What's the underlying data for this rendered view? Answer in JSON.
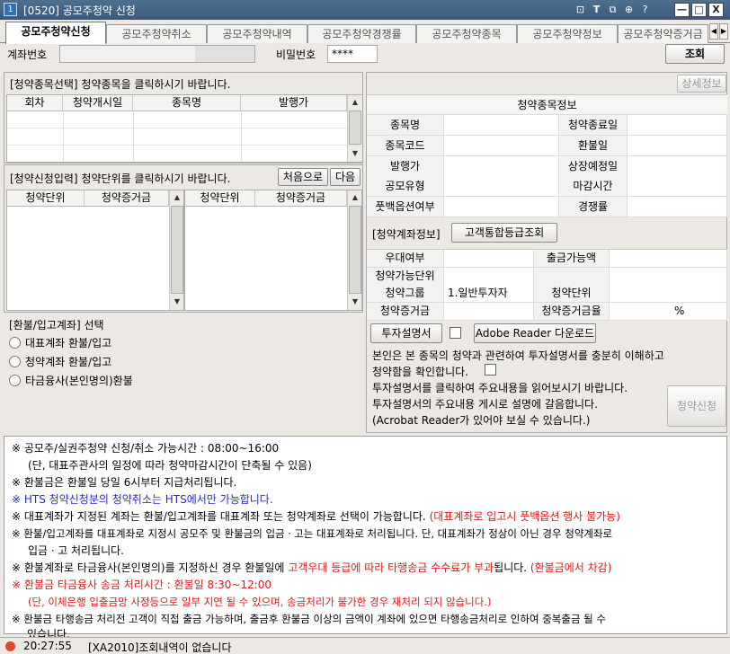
{
  "window": {
    "icon": "1",
    "title": "[0520] 공모주청약 신청",
    "controls": [
      "pin-icon",
      "text-icon",
      "copy-icon",
      "link-icon",
      "help-icon",
      "minimize-icon",
      "maximize-icon",
      "close-icon"
    ],
    "control_glyphs": [
      "⊡",
      "T",
      "⧉",
      "⊕",
      "?"
    ],
    "box_glyphs": [
      "—",
      "□",
      "X"
    ]
  },
  "tabs": [
    "공모주청약신청",
    "공모주청약취소",
    "공모주청약내역",
    "공모주청약경쟁률",
    "공모주청약종목",
    "공모주청약정보",
    "공모주청약증거금"
  ],
  "tab_arrows": {
    "left": "◀",
    "right": "▶"
  },
  "account": {
    "label": "계좌번호",
    "value": "",
    "password_label": "비밀번호",
    "password_value": "****",
    "query_button": "조회"
  },
  "stock_select": {
    "header": "[청약종목선택] 청약종목을 클릭하시기 바랍니다.",
    "columns": [
      "회차",
      "청약개시일",
      "종목명",
      "발행가"
    ]
  },
  "scroll_glyphs": {
    "up": "▲",
    "down": "▼"
  },
  "detail_button": "상세정보",
  "stock_info": {
    "title": "청약종목정보",
    "rows": [
      [
        "종목명",
        "",
        "청약종료일",
        ""
      ],
      [
        "종목코드",
        "",
        "환불일",
        ""
      ],
      [
        "발행가",
        "",
        "상장예정일",
        ""
      ],
      [
        "공모유형",
        "",
        "마감시간",
        ""
      ],
      [
        "풋백옵션여부",
        "",
        "경쟁률",
        ""
      ]
    ]
  },
  "apply_input": {
    "header": "[청약신청입력] 청약단위를 클릭하시기 바랍니다.",
    "first_button": "처음으로",
    "next_button": "다음",
    "columns": [
      "청약단위",
      "청약증거금",
      "청약단위",
      "청약증거금"
    ]
  },
  "account_info": {
    "header": "[청약계좌정보]",
    "grade_button": "고객통합등급조회",
    "rows": [
      [
        "우대여부",
        "",
        "출금가능액",
        ""
      ],
      [
        "청약가능단위",
        "",
        "",
        ""
      ],
      [
        "청약그룹",
        "1.일반투자자",
        "청약단위",
        ""
      ],
      [
        "청약증거금",
        "",
        "청약증거금율",
        "%"
      ]
    ]
  },
  "refund": {
    "header": "[환불/입고계좌] 선택",
    "options": [
      "대표계좌 환불/입고",
      "청약계좌 환불/입고",
      "타금융사(본인명의)환불"
    ]
  },
  "prospectus": {
    "button": "투자설명서",
    "adobe_button": "Adobe Reader 다운로드",
    "line1": "본인은 본 종목의 청약과 관련하여 투자설명서를 충분히 이해하고",
    "line2": "청약함을 확인합니다.",
    "line3": "투자설명서를 클릭하여 주요내용을 읽어보시기 바랍니다.",
    "line4": "투자설명서의 주요내용 게시로 설명에 갈음합니다.",
    "line5": "(Acrobat Reader가 있어야 보실 수 있습니다.)",
    "apply_button": "청약신청"
  },
  "notes": {
    "mark": "※",
    "n1": "공모주/실권주청약 신청/취소 가능시간 : 08:00~16:00",
    "n1b": "(단, 대표주관사의 일정에 따라 청약마감시간이 단축될 수 있음)",
    "n2": "환불금은 환불일 당일 6시부터 지급처리됩니다.",
    "n3": "HTS 청약신청분의 청약취소는 HTS에서만 가능합니다.",
    "n4a": "대표계좌가 지정된 계좌는 환불/입고계좌를 대표계좌 또는 청약계좌로 선택이 가능합니다.",
    "n4b": "(대표계좌로 입고시 풋백옵션 행사 불가능)",
    "n5a": "환불/입고계좌를 대표계좌로 지정시 공모주 및 환불금의 입금ㆍ고는 대표계좌로 처리됩니다. 단, 대표계좌가 정상이 아닌 경우 청약계좌로",
    "n5b": "입금ㆍ고 처리됩니다.",
    "n6a": "환불계좌로 타금융사(본인명의)를 지정하신 경우 환불일에",
    "n6b": "고객우대 등급에 따라 타행송금 수수료가 부과",
    "n6c": "됩니다.",
    "n6d": "(환불금에서 차감)",
    "n7": "환불금 타금융사 송금 처리시간 : 환불일 8:30~12:00",
    "n7b": "(단, 이체은행 입출금망 사정등으로 일부 지연 될 수 있으며, 송금처리가 불가한 경우 재처리 되지 않습니다.)",
    "n8a": "환불금 타행송금 처리전 고객이 직접 출금 가능하며, 출금후 환불금 이상의 금액이 계좌에 있으면 타행송금처리로 인하여 중복출금 될 수",
    "n8b": "있습니다."
  },
  "status": {
    "time": "20:27:55",
    "message": "[XA2010]조회내역이 없습니다"
  },
  "colors": {
    "title_bar": "#3b5a79",
    "notice_red": "#e01818",
    "notice_blue": "#2a2ae0",
    "status_icon": "#d94a2a"
  }
}
